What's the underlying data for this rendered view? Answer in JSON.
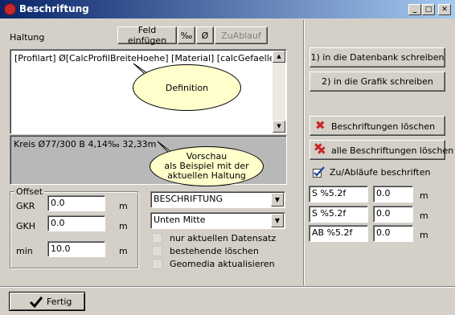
{
  "window": {
    "title": "Beschriftung",
    "controls": {
      "minimize": "_",
      "maximize": "□",
      "close": "✕"
    }
  },
  "left": {
    "haltung_label": "Haltung",
    "toolbar": {
      "feld_einfuegen": "Feld einfügen",
      "promille": "‰",
      "durchmesser": "Ø",
      "zuablauf": "ZuAblauf"
    },
    "definition_text": "[Profilart] Ø[CalcProfilBreiteHoehe] [Material] [calcGefaelle]‰ [calc",
    "definition_callout": "Definition",
    "preview_text": "Kreis Ø77/300 B 4,14‰ 32,33m",
    "preview_callout": "Vorschau\nals Beispiel mit der\naktuellen Haltung",
    "offset": {
      "legend": "Offset",
      "rows": [
        {
          "label": "GKR",
          "value": "0.0",
          "unit": "m"
        },
        {
          "label": "GKH",
          "value": "0.0",
          "unit": "m"
        },
        {
          "label": "min",
          "value": "10.0",
          "unit": "m"
        }
      ]
    },
    "layer_select": "BESCHRIFTUNG",
    "position_select": "Unten Mitte",
    "checkboxes": [
      {
        "label": "nur aktuellen Datensatz",
        "checked": false
      },
      {
        "label": "bestehende löschen",
        "checked": false
      },
      {
        "label": "Geomedia aktualisieren",
        "checked": false
      }
    ],
    "fertig_button": "Fertig"
  },
  "right": {
    "db_button": "1) in die Datenbank schreiben",
    "grafik_button": "2) in die Grafik schreiben",
    "delete_button": "Beschriftungen löschen",
    "delete_all_button": "alle Beschriftungen löschen",
    "zuablauf_label": "Zu/Abläufe beschriften",
    "zuablauf_rows": [
      {
        "format": "S %5.2f",
        "value": "0.0",
        "unit": "m"
      },
      {
        "format": "S %5.2f",
        "value": "0.0",
        "unit": "m"
      },
      {
        "format": "AB %5.2f",
        "value": "0.0",
        "unit": "m"
      }
    ]
  },
  "colors": {
    "titlebar_start": "#0a246a",
    "titlebar_end": "#a6caf0",
    "face": "#d4d0c8",
    "callout": "#ffffcc",
    "delete_red": "#c62828"
  }
}
